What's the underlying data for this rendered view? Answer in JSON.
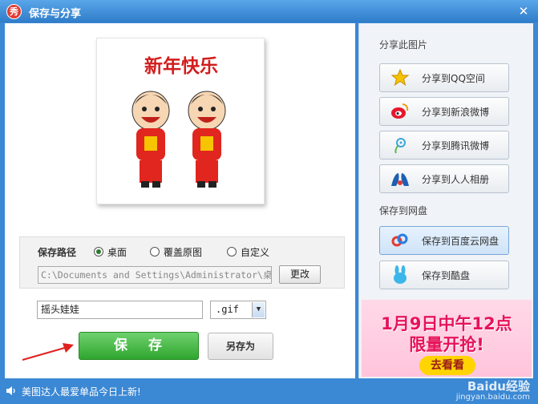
{
  "window": {
    "title": "保存与分享",
    "app_icon_glyph": "秀",
    "close_glyph": "✕"
  },
  "preview": {
    "caption": "新年快乐"
  },
  "save_path": {
    "label": "保存路径",
    "options": [
      {
        "label": "桌面",
        "selected": true
      },
      {
        "label": "覆盖原图",
        "selected": false
      },
      {
        "label": "自定义",
        "selected": false
      }
    ],
    "path_value": "C:\\Documents and Settings\\Administrator\\桌",
    "change_label": "更改"
  },
  "file": {
    "name": "摇头娃娃",
    "format": ".gif"
  },
  "actions": {
    "save_label": "保 存",
    "save_as_label": "另存为"
  },
  "share": {
    "section_title": "分享此图片",
    "items": [
      {
        "label": "分享到QQ空间",
        "icon": "qzone-star-icon"
      },
      {
        "label": "分享到新浪微博",
        "icon": "sina-weibo-icon"
      },
      {
        "label": "分享到腾讯微博",
        "icon": "tencent-weibo-icon"
      },
      {
        "label": "分享到人人相册",
        "icon": "renren-icon"
      }
    ]
  },
  "cloud": {
    "section_title": "保存到网盘",
    "items": [
      {
        "label": "保存到百度云网盘",
        "icon": "baidu-cloud-icon",
        "active": true
      },
      {
        "label": "保存到酷盘",
        "icon": "kupan-rabbit-icon",
        "active": false
      }
    ]
  },
  "ad": {
    "line1": "1月9日中午12点",
    "line2": "限量开抢!",
    "button": "去看看"
  },
  "status": {
    "text": "美图达人最爱单品今日上新!"
  },
  "watermark": {
    "text": "Baidu经验",
    "sub": "jingyan.baidu.com"
  },
  "colors": {
    "title_bar": "#3b88d4",
    "save_green": "#2fa62f",
    "ad_pink": "#e6135a"
  }
}
